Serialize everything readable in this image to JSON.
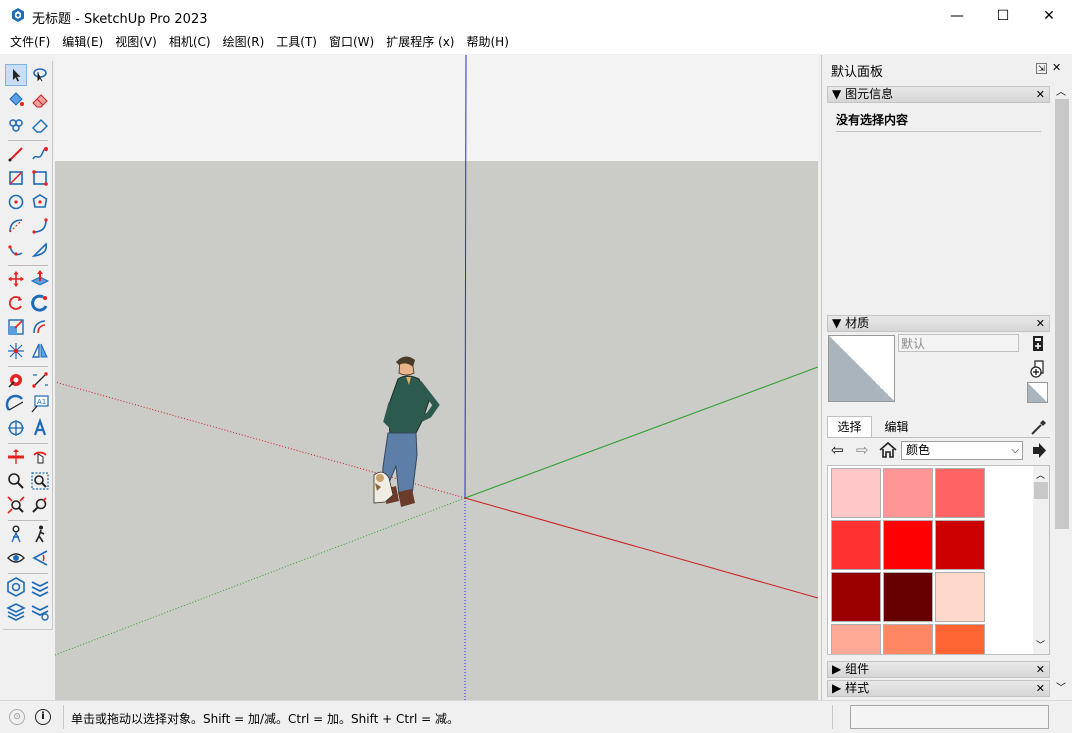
{
  "window": {
    "title": "无标题 - SketchUp Pro 2023",
    "minimize": "—",
    "maximize": "☐",
    "close": "✕"
  },
  "menu": [
    "文件(F)",
    "编辑(E)",
    "视图(V)",
    "相机(C)",
    "绘图(R)",
    "工具(T)",
    "窗口(W)",
    "扩展程序 (x)",
    "帮助(H)"
  ],
  "tray": {
    "title": "默认面板",
    "entity_info": {
      "title": "图元信息",
      "empty_text": "没有选择内容"
    },
    "materials": {
      "title": "材质",
      "material_name": "默认",
      "tabs": [
        "选择",
        "编辑"
      ],
      "collection": "颜色",
      "swatch_colors": [
        "#ffc8c8",
        "#ff9696",
        "#ff6464",
        "#ff3232",
        "#ff0000",
        "#cc0000",
        "#990000",
        "#660000",
        "#ffd8cc",
        "#ffaa96",
        "#ff8864",
        "#ff6432"
      ]
    },
    "components": {
      "title": "组件"
    },
    "styles": {
      "title": "样式"
    }
  },
  "status": {
    "hint": "单击或拖动以选择对象。Shift = 加/减。Ctrl = 加。Shift + Ctrl = 减。"
  },
  "colors": {
    "sky": "#f4f4f4",
    "ground": "#cbcbc7",
    "blue_axis": "#2a2ad8",
    "red_axis": "#cc2020",
    "green_axis": "#2aa02a",
    "accent_red": "#e82020"
  }
}
